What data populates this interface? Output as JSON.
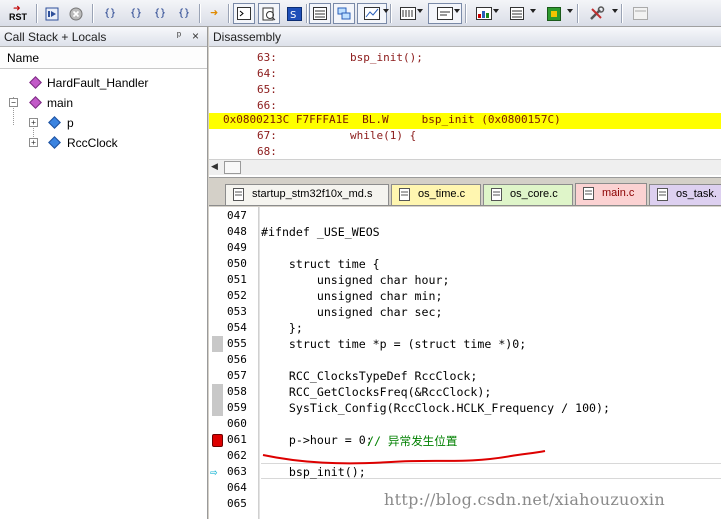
{
  "toolbar": {
    "rst_label": "RST",
    "icons": [
      "reset-icon",
      "run-icon",
      "stop-icon",
      "step-into-icon",
      "step-over-icon",
      "step-out-icon",
      "run-to-cursor-icon",
      "show-next-statement-icon",
      "command-window-icon",
      "disassembly-window-icon",
      "symbols-window-icon",
      "registers-window-icon",
      "call-stack-window-icon",
      "watch-window-icon",
      "memory-window-icon",
      "serial-window-icon",
      "analysis-window-icon",
      "trace-window-icon",
      "system-viewer-icon",
      "toolbox-icon",
      "debug-restore-views-icon"
    ],
    "brace_labels": [
      "{}",
      "{}",
      "{}",
      "{}"
    ]
  },
  "callstack": {
    "title": "Call Stack + Locals",
    "pin_glyph": "ᵖ",
    "close_glyph": "×",
    "column_header": "Name",
    "rows": [
      {
        "label": "HardFault_Handler",
        "type": "function"
      },
      {
        "label": "main",
        "type": "function",
        "expander": "−"
      },
      {
        "label": "p",
        "type": "variable",
        "expander": "+"
      },
      {
        "label": "RccClock",
        "type": "variable",
        "expander": "+"
      }
    ]
  },
  "disassembly": {
    "title": "Disassembly",
    "lines": [
      {
        "num": "63:",
        "code": "bsp_init();"
      },
      {
        "num": "64:",
        "code": ""
      },
      {
        "num": "65:",
        "code": ""
      },
      {
        "num": "66:",
        "code": ""
      },
      {
        "highlight": "0x0800213C F7FFFA1E  BL.W     bsp_init (0x0800157C)"
      },
      {
        "num": "67:",
        "code": "while(1) {"
      },
      {
        "num": "68:",
        "code": ""
      }
    ]
  },
  "tabs": [
    {
      "label": "startup_stm32f10x_md.s",
      "color": "#f5f4ef",
      "active": false
    },
    {
      "label": "os_time.c",
      "color": "#fff6b0",
      "active": false
    },
    {
      "label": "os_core.c",
      "color": "#dff5c9",
      "active": false
    },
    {
      "label": "main.c",
      "color": "#fbd2d2",
      "active": true
    },
    {
      "label": "os_task.",
      "color": "#ddd0f0",
      "active": false
    }
  ],
  "editor": {
    "lines": [
      {
        "n": "047",
        "code": "",
        "marker": "none"
      },
      {
        "n": "048",
        "code": "#ifndef _USE_WEOS",
        "marker": "none"
      },
      {
        "n": "049",
        "code": "",
        "marker": "none"
      },
      {
        "n": "050",
        "code": "    struct time {",
        "marker": "none"
      },
      {
        "n": "051",
        "code": "        unsigned char hour;",
        "marker": "none"
      },
      {
        "n": "052",
        "code": "        unsigned char min;",
        "marker": "none"
      },
      {
        "n": "053",
        "code": "        unsigned char sec;",
        "marker": "none"
      },
      {
        "n": "054",
        "code": "    };",
        "marker": "none"
      },
      {
        "n": "055",
        "code": "    struct time *p = (struct time *)0;",
        "marker": "gray"
      },
      {
        "n": "056",
        "code": "",
        "marker": "none"
      },
      {
        "n": "057",
        "code": "    RCC_ClocksTypeDef RccClock;",
        "marker": "none"
      },
      {
        "n": "058",
        "code": "    RCC_GetClocksFreq(&RccClock);",
        "marker": "gray"
      },
      {
        "n": "059",
        "code": "    SysTick_Config(RccClock.HCLK_Frequency / 100);",
        "marker": "gray"
      },
      {
        "n": "060",
        "code": "",
        "marker": "none"
      },
      {
        "n": "061",
        "code": "    p->hour = 0;",
        "comment": "  // 异常发生位置",
        "marker": "breakpoint"
      },
      {
        "n": "062",
        "code": "",
        "marker": "none"
      },
      {
        "n": "063",
        "code": "    bsp_init();",
        "marker": "current"
      },
      {
        "n": "064",
        "code": "",
        "marker": "none"
      },
      {
        "n": "065",
        "code": "",
        "marker": "none"
      }
    ],
    "watermark": "http://blog.csdn.net/xiahouzuoxin"
  },
  "colors": {
    "disasm_highlight": "#ffff00",
    "disasm_text": "#8b1a1a",
    "comment": "#008000",
    "breakpoint": "#dd0000",
    "current_arrow": "#1cb6d4",
    "annotation_underline": "#dd0000"
  }
}
